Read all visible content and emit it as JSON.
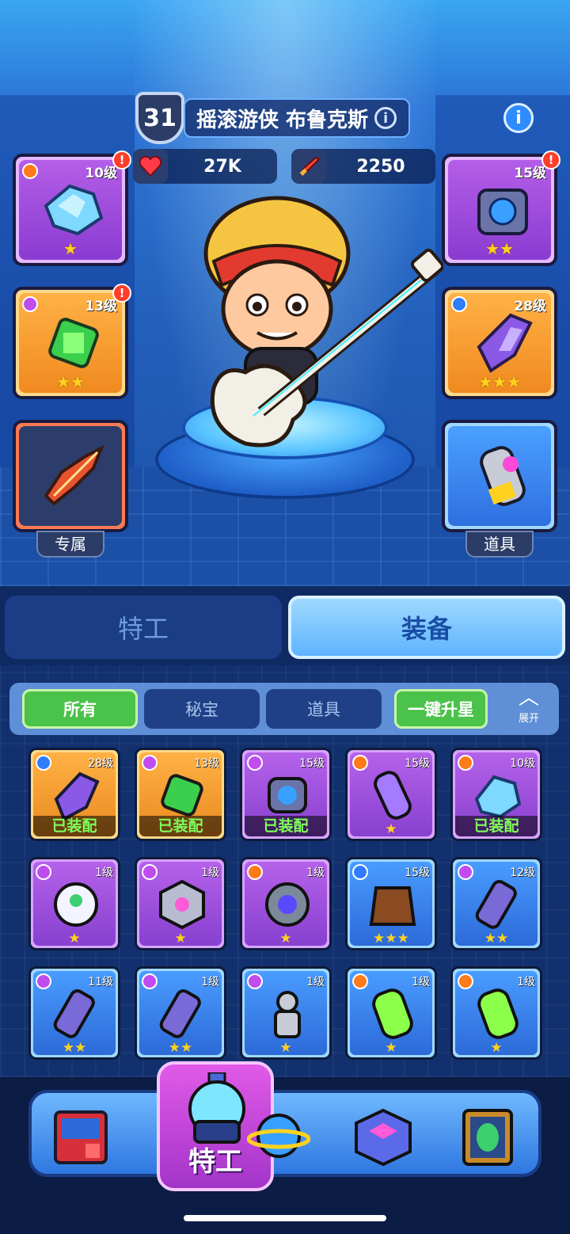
{
  "hero": {
    "level": "31",
    "name": "摇滚游侠 布鲁克斯",
    "hp": "27K",
    "attack": "2250"
  },
  "slots": {
    "left": [
      {
        "level": "10级",
        "stars": "★",
        "rarity": "red"
      },
      {
        "level": "13级",
        "stars": "★★",
        "rarity": "purple"
      },
      {
        "label": "专属"
      }
    ],
    "right": [
      {
        "level": "15级",
        "stars": "★★",
        "rarity": "none"
      },
      {
        "level": "28级",
        "stars": "★★★",
        "rarity": "blue"
      },
      {
        "label": "道具"
      }
    ]
  },
  "tabs": {
    "agent": "特工",
    "equipment": "装备"
  },
  "filters": {
    "all": "所有",
    "secret": "秘宝",
    "items": "道具",
    "upgrade": "一键升星",
    "expand": "展开"
  },
  "items": [
    {
      "level": "28级",
      "status": "已装配",
      "color": "orange",
      "rarity": "blue"
    },
    {
      "level": "13级",
      "status": "已装配",
      "color": "orange",
      "rarity": "purple"
    },
    {
      "level": "15级",
      "status": "已装配",
      "color": "purple",
      "rarity": "purple"
    },
    {
      "level": "15级",
      "stars": "★",
      "color": "purple",
      "rarity": "orange"
    },
    {
      "level": "10级",
      "status": "已装配",
      "color": "purple",
      "rarity": "orange"
    },
    {
      "level": "1级",
      "stars": "★",
      "color": "purple",
      "rarity": "purple"
    },
    {
      "level": "1级",
      "stars": "★",
      "color": "purple",
      "rarity": "purple"
    },
    {
      "level": "1级",
      "stars": "★",
      "color": "purple",
      "rarity": "orange"
    },
    {
      "level": "15级",
      "stars": "★★★",
      "color": "blue",
      "rarity": "blue"
    },
    {
      "level": "12级",
      "stars": "★★",
      "color": "blue",
      "rarity": "purple"
    },
    {
      "level": "11级",
      "stars": "★★",
      "color": "blue",
      "rarity": "purple"
    },
    {
      "level": "1级",
      "stars": "★★",
      "color": "blue",
      "rarity": "purple"
    },
    {
      "level": "1级",
      "stars": "★",
      "color": "blue",
      "rarity": "purple"
    },
    {
      "level": "1级",
      "stars": "★",
      "color": "blue",
      "rarity": "orange"
    },
    {
      "level": "1级",
      "stars": "★",
      "color": "blue",
      "rarity": "orange"
    }
  ],
  "nav": {
    "active_label": "特工"
  },
  "colors": {
    "rarity_purple": "#c04cf0",
    "rarity_orange": "#ff7b1a",
    "rarity_blue": "#2f7cff",
    "equipped_text": "#7dff5a",
    "active_filter": "#4bc24a"
  }
}
